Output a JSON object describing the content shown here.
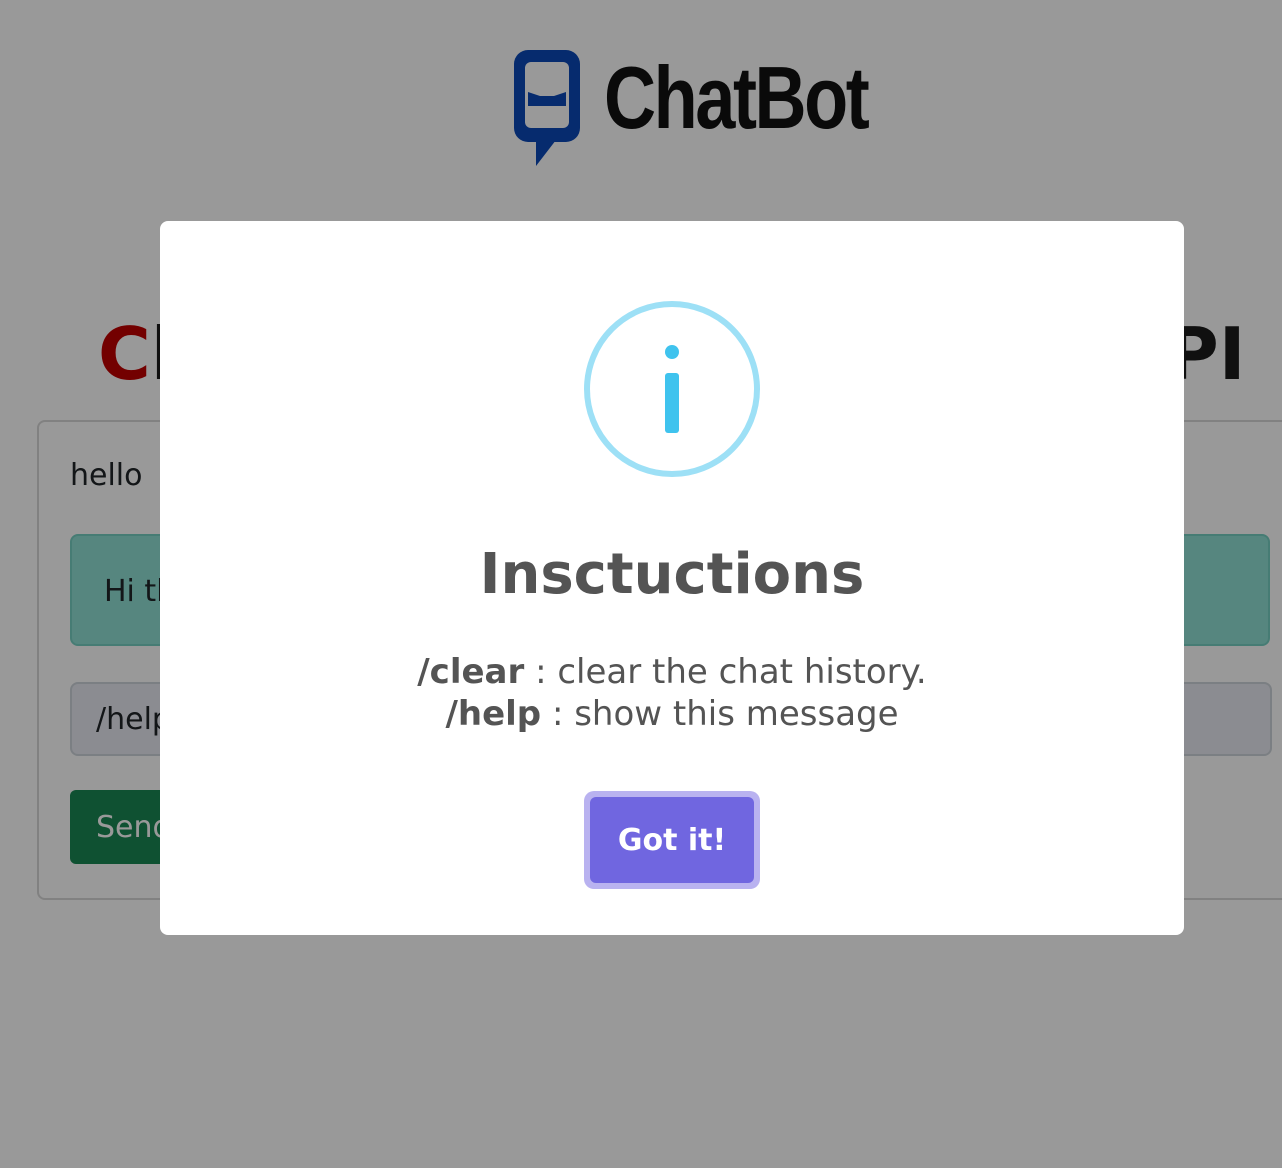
{
  "brand": {
    "name": "ChatBot",
    "icon": "chatbot-logo-icon",
    "logo_color": "#0b49b8"
  },
  "page": {
    "heading_first": "C",
    "heading_rest": "l",
    "heading_tail": "PI",
    "accent_color": "#c00000"
  },
  "chat": {
    "messages": [
      {
        "role": "user",
        "text": "hello"
      },
      {
        "role": "bot",
        "text": "Hi th"
      }
    ],
    "input_value": "/help",
    "send_label": "Send"
  },
  "modal": {
    "icon": "info-icon",
    "icon_color": "#3fc3ee",
    "title": "Insctuctions",
    "commands": [
      {
        "command": "/clear",
        "description": ": clear the chat history."
      },
      {
        "command": "/help",
        "description": ": show this message"
      }
    ],
    "confirm_label": "Got it!",
    "confirm_color": "#7066e0"
  }
}
